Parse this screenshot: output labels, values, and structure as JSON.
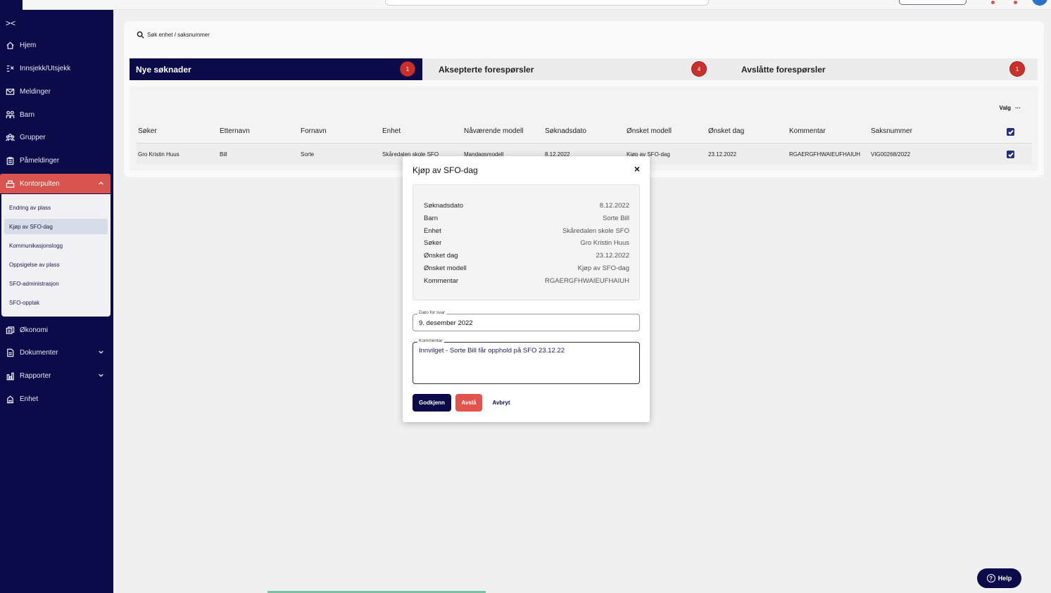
{
  "sidebar": {
    "collapse_glyph": "><",
    "items": [
      {
        "label": "Hjem",
        "icon": "home-icon"
      },
      {
        "label": "Innsjekk/Utsjekk",
        "icon": "checkin-icon"
      },
      {
        "label": "Meldinger",
        "icon": "mail-icon"
      },
      {
        "label": "Barn",
        "icon": "children-icon"
      },
      {
        "label": "Grupper",
        "icon": "groups-icon"
      },
      {
        "label": "Påmeldinger",
        "icon": "registration-icon"
      },
      {
        "label": "Kontorpulten",
        "icon": "desk-icon"
      },
      {
        "label": "Økonomi",
        "icon": "money-icon"
      },
      {
        "label": "Dokumenter",
        "icon": "document-icon"
      },
      {
        "label": "Rapporter",
        "icon": "chart-icon"
      },
      {
        "label": "Enhet",
        "icon": "building-icon"
      }
    ],
    "submenu": [
      "Endring av plass",
      "Kjøp av SFO-dag",
      "Kommunikasjonslogg",
      "Oppsigelse av plass",
      "SFO-administrasjon",
      "SFO-opptak"
    ]
  },
  "search": {
    "label": "Søk enhet / saksnummer"
  },
  "tabs": [
    {
      "label": "Nye søknader",
      "count": "1"
    },
    {
      "label": "Aksepterte forespørsler",
      "count": "4"
    },
    {
      "label": "Avslåtte forespørsler",
      "count": "1"
    }
  ],
  "table": {
    "options_label": "Valg",
    "options_glyph": "···",
    "headers": [
      "Søker",
      "Etternavn",
      "Fornavn",
      "Enhet",
      "Nåværende modell",
      "Søknadsdato",
      "Ønsket modell",
      "Ønsket dag",
      "Kommentar",
      "Saksnummer"
    ],
    "rows": [
      [
        "Gro Kristin Huus",
        "Bill",
        "Sorte",
        "Skåredalen skole SFO",
        "Mandagsmodell",
        "8.12.2022",
        "Kjøp av SFO-dag",
        "23.12.2022",
        "RGAERGFHWAIEUFHAIUH",
        "VIG00268/2022"
      ]
    ]
  },
  "modal": {
    "title": "Kjøp av SFO-dag",
    "close_glyph": "×",
    "details": [
      {
        "key": "Søknadsdato",
        "value": "8.12.2022"
      },
      {
        "key": "Barn",
        "value": "Sorte Bill"
      },
      {
        "key": "Enhet",
        "value": "Skåredalen skole SFO"
      },
      {
        "key": "Søker",
        "value": "Gro Kristin Huus"
      },
      {
        "key": "Ønsket dag",
        "value": "23.12.2022"
      },
      {
        "key": "Ønsket modell",
        "value": "Kjøp av SFO-dag"
      },
      {
        "key": "Kommentar",
        "value": "RGAERGFHWAIEUFHAIUH"
      }
    ],
    "date_field": {
      "label": "Dato for svar",
      "value": "9. desember 2022"
    },
    "comment_field": {
      "label": "Kommentar",
      "value": "Innvilget - Sorte Bill får opphold på SFO 23.12.22"
    },
    "buttons": {
      "approve": "Godkjenn",
      "reject": "Avslå",
      "cancel": "Avbryt"
    }
  },
  "help": {
    "label": "Help",
    "glyph": "?"
  },
  "colors": {
    "navy": "#0b0b4a",
    "accent_red": "#d9534f",
    "badge_red": "#c9302c"
  }
}
